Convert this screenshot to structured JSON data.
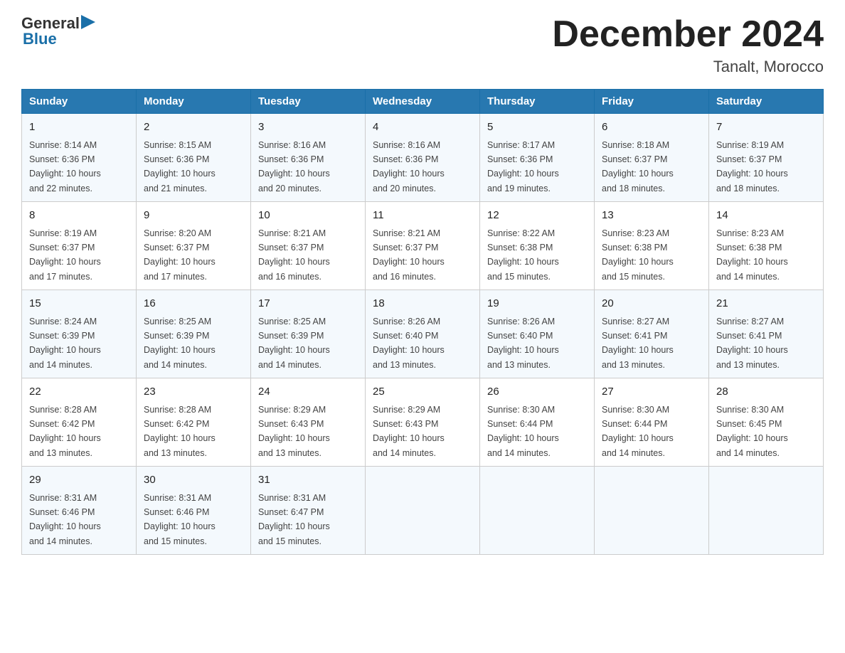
{
  "header": {
    "logo": {
      "general": "General",
      "blue": "Blue",
      "triangle": "▶"
    },
    "title": "December 2024",
    "location": "Tanalt, Morocco"
  },
  "weekdays": [
    "Sunday",
    "Monday",
    "Tuesday",
    "Wednesday",
    "Thursday",
    "Friday",
    "Saturday"
  ],
  "weeks": [
    [
      {
        "day": "1",
        "sunrise": "8:14 AM",
        "sunset": "6:36 PM",
        "daylight": "10 hours and 22 minutes."
      },
      {
        "day": "2",
        "sunrise": "8:15 AM",
        "sunset": "6:36 PM",
        "daylight": "10 hours and 21 minutes."
      },
      {
        "day": "3",
        "sunrise": "8:16 AM",
        "sunset": "6:36 PM",
        "daylight": "10 hours and 20 minutes."
      },
      {
        "day": "4",
        "sunrise": "8:16 AM",
        "sunset": "6:36 PM",
        "daylight": "10 hours and 20 minutes."
      },
      {
        "day": "5",
        "sunrise": "8:17 AM",
        "sunset": "6:36 PM",
        "daylight": "10 hours and 19 minutes."
      },
      {
        "day": "6",
        "sunrise": "8:18 AM",
        "sunset": "6:37 PM",
        "daylight": "10 hours and 18 minutes."
      },
      {
        "day": "7",
        "sunrise": "8:19 AM",
        "sunset": "6:37 PM",
        "daylight": "10 hours and 18 minutes."
      }
    ],
    [
      {
        "day": "8",
        "sunrise": "8:19 AM",
        "sunset": "6:37 PM",
        "daylight": "10 hours and 17 minutes."
      },
      {
        "day": "9",
        "sunrise": "8:20 AM",
        "sunset": "6:37 PM",
        "daylight": "10 hours and 17 minutes."
      },
      {
        "day": "10",
        "sunrise": "8:21 AM",
        "sunset": "6:37 PM",
        "daylight": "10 hours and 16 minutes."
      },
      {
        "day": "11",
        "sunrise": "8:21 AM",
        "sunset": "6:37 PM",
        "daylight": "10 hours and 16 minutes."
      },
      {
        "day": "12",
        "sunrise": "8:22 AM",
        "sunset": "6:38 PM",
        "daylight": "10 hours and 15 minutes."
      },
      {
        "day": "13",
        "sunrise": "8:23 AM",
        "sunset": "6:38 PM",
        "daylight": "10 hours and 15 minutes."
      },
      {
        "day": "14",
        "sunrise": "8:23 AM",
        "sunset": "6:38 PM",
        "daylight": "10 hours and 14 minutes."
      }
    ],
    [
      {
        "day": "15",
        "sunrise": "8:24 AM",
        "sunset": "6:39 PM",
        "daylight": "10 hours and 14 minutes."
      },
      {
        "day": "16",
        "sunrise": "8:25 AM",
        "sunset": "6:39 PM",
        "daylight": "10 hours and 14 minutes."
      },
      {
        "day": "17",
        "sunrise": "8:25 AM",
        "sunset": "6:39 PM",
        "daylight": "10 hours and 14 minutes."
      },
      {
        "day": "18",
        "sunrise": "8:26 AM",
        "sunset": "6:40 PM",
        "daylight": "10 hours and 13 minutes."
      },
      {
        "day": "19",
        "sunrise": "8:26 AM",
        "sunset": "6:40 PM",
        "daylight": "10 hours and 13 minutes."
      },
      {
        "day": "20",
        "sunrise": "8:27 AM",
        "sunset": "6:41 PM",
        "daylight": "10 hours and 13 minutes."
      },
      {
        "day": "21",
        "sunrise": "8:27 AM",
        "sunset": "6:41 PM",
        "daylight": "10 hours and 13 minutes."
      }
    ],
    [
      {
        "day": "22",
        "sunrise": "8:28 AM",
        "sunset": "6:42 PM",
        "daylight": "10 hours and 13 minutes."
      },
      {
        "day": "23",
        "sunrise": "8:28 AM",
        "sunset": "6:42 PM",
        "daylight": "10 hours and 13 minutes."
      },
      {
        "day": "24",
        "sunrise": "8:29 AM",
        "sunset": "6:43 PM",
        "daylight": "10 hours and 13 minutes."
      },
      {
        "day": "25",
        "sunrise": "8:29 AM",
        "sunset": "6:43 PM",
        "daylight": "10 hours and 14 minutes."
      },
      {
        "day": "26",
        "sunrise": "8:30 AM",
        "sunset": "6:44 PM",
        "daylight": "10 hours and 14 minutes."
      },
      {
        "day": "27",
        "sunrise": "8:30 AM",
        "sunset": "6:44 PM",
        "daylight": "10 hours and 14 minutes."
      },
      {
        "day": "28",
        "sunrise": "8:30 AM",
        "sunset": "6:45 PM",
        "daylight": "10 hours and 14 minutes."
      }
    ],
    [
      {
        "day": "29",
        "sunrise": "8:31 AM",
        "sunset": "6:46 PM",
        "daylight": "10 hours and 14 minutes."
      },
      {
        "day": "30",
        "sunrise": "8:31 AM",
        "sunset": "6:46 PM",
        "daylight": "10 hours and 15 minutes."
      },
      {
        "day": "31",
        "sunrise": "8:31 AM",
        "sunset": "6:47 PM",
        "daylight": "10 hours and 15 minutes."
      },
      null,
      null,
      null,
      null
    ]
  ],
  "labels": {
    "sunrise": "Sunrise:",
    "sunset": "Sunset:",
    "daylight": "Daylight:"
  }
}
